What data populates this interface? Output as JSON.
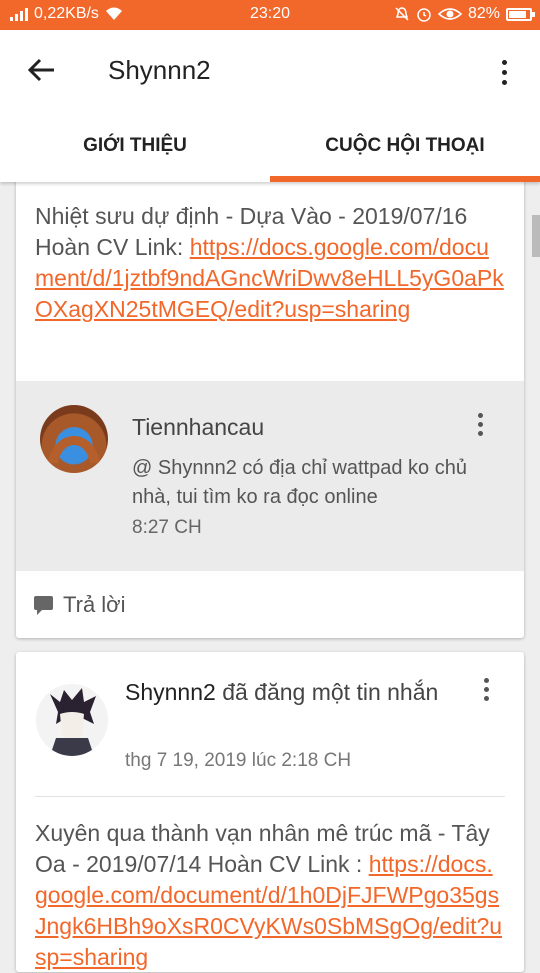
{
  "status_bar": {
    "network_speed": "0,22KB/s",
    "time": "23:20",
    "battery": "82%"
  },
  "header": {
    "title": "Shynnn2",
    "tabs": [
      {
        "label": "GIỚI THIỆU",
        "active": false
      },
      {
        "label": "CUỘC HỘI THOẠI",
        "active": true
      }
    ]
  },
  "thread1": {
    "message_prefix": "Nhiệt sưu dự định - Dựa Vào - 2019/07/16 Hoàn CV Link: ",
    "message_link": "https://docs.google.com/document/d/1jztbf9ndAGncWriDwv8eHLL5yG0aPkOXagXN25tMGEQ/edit?usp=sharing",
    "reply": {
      "author": "Tiennhancau",
      "text": "@ Shynnn2  có địa chỉ wattpad ko chủ nhà, tui tìm ko ra đọc online",
      "time": "8:27 CH"
    },
    "reply_button": "Trả lời"
  },
  "post2": {
    "author": "Shynnn2",
    "action": "đã đăng một tin nhắn",
    "timestamp": "thg 7 19, 2019 lúc 2:18 CH",
    "message_prefix": "Xuyên qua thành vạn nhân mê trúc mã - Tây Oa - 2019/07/14 Hoàn CV Link : ",
    "message_link": "https://docs.google.com/document/d/1h0DjFJFWPgo35gsJngk6HBh9oXsR0CVyKWs0SbMSgOg/edit?usp=sharing"
  },
  "colors": {
    "accent": "#f2672a",
    "reply_background": "#ebebeb",
    "page_background": "#eeeeee"
  },
  "icons": [
    "signal-icon",
    "wifi-icon",
    "mute-icon",
    "alarm-icon",
    "eye-icon",
    "battery-icon",
    "back-arrow-icon",
    "more-vert-icon",
    "avatar",
    "reply-bubble-icon"
  ]
}
